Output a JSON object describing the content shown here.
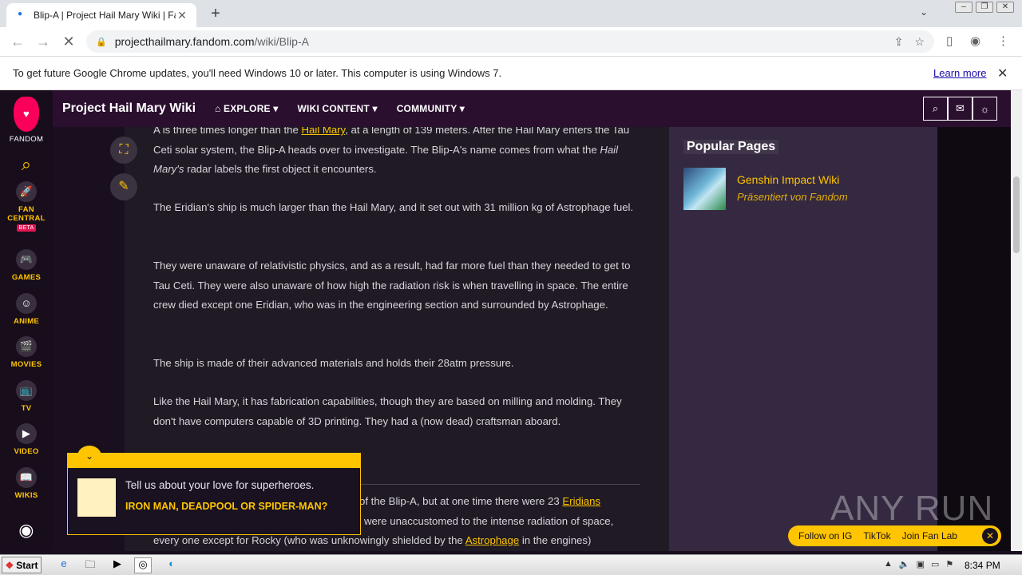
{
  "browser": {
    "tab_title": "Blip-A | Project Hail Mary Wiki | Fandom",
    "tab_close": "✕",
    "new_tab": "+",
    "url_host": "projecthailmary.fandom.com",
    "url_path": "/wiki/Blip-A",
    "info_text": "To get future Google Chrome updates, you'll need Windows 10 or later. This computer is using Windows 7.",
    "learn_more": "Learn more"
  },
  "rail": {
    "fandom": "FANDOM",
    "fan_central": "FAN CENTRAL",
    "beta": "BETA",
    "games": "GAMES",
    "anime": "ANIME",
    "movies": "MOVIES",
    "tv": "TV",
    "video": "VIDEO",
    "wikis": "WIKIS"
  },
  "wikibar": {
    "title": "Project Hail Mary Wiki",
    "explore": "EXPLORE ▾",
    "wiki_content": "WIKI CONTENT ▾",
    "community": "COMMUNITY ▾"
  },
  "article": {
    "p1_a": "A is three times longer than the ",
    "p1_link": "Hail Mary",
    "p1_b": ", at a length of 139 meters. After the Hail Mary enters the Tau Ceti solar system, the Blip-A heads over to investigate. The Blip-A's name comes from what the ",
    "p1_em": "Hail Mary's",
    "p1_c": " radar labels the first object it encounters.",
    "p2": "The Eridian's ship is much larger than the Hail Mary, and it set out with 31 million kg of Astrophage fuel.",
    "p3": "They were unaware of relativistic physics, and as a result, had far more fuel than they needed to get to Tau Ceti. They were also unaware of how high the radiation risk is when travelling in space. The entire crew died except one Eridian, who was in the engineering section and surrounded by Astrophage.",
    "p4": "The ship is made of their advanced materials and holds their 28atm pressure.",
    "p5": "Like the Hail Mary, it has fabrication capabilities, though they are based on milling and molding. They don't have computers capable of 3D printing. They had a (now dead) craftsman aboard.",
    "p6_a": "of the Blip-A, but at one time there were 23 ",
    "p6_link": "Eridians",
    "p7": "were unaccustomed to the intense radiation of space,",
    "p8_a": "every one except for Rocky (who was unknowingly shielded by the ",
    "p8_link": "Astrophage",
    "p8_b": " in the engines)"
  },
  "sidebar": {
    "heading": "Popular Pages",
    "item_title": "Genshin Impact Wiki",
    "item_sub": "Präsentiert von Fandom"
  },
  "quiz": {
    "question": "Tell us about your love for superheroes.",
    "answer": "IRON MAN, DEADPOOL OR SPIDER-MAN?"
  },
  "follow": {
    "ig": "Follow on IG",
    "tiktok": "TikTok",
    "fanlab": "Join Fan Lab",
    "close": "✕"
  },
  "watermark": "ANY RUN",
  "taskbar": {
    "start": "Start",
    "clock": "8:34 PM"
  },
  "colors": {
    "accent": "#ffc500",
    "wiki_bar": "#2b0f2f",
    "content_bg": "#1f1a24",
    "sidebar_bg": "#342940"
  }
}
